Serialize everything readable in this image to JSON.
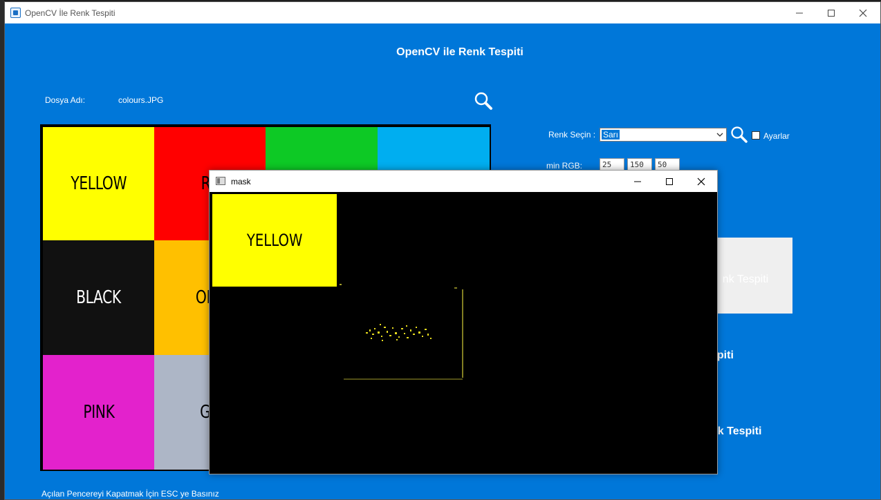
{
  "window": {
    "title": "OpenCV İle Renk Tespiti",
    "minimize_icon": "minimize-icon",
    "maximize_icon": "maximize-icon",
    "close_icon": "close-icon"
  },
  "main": {
    "heading": "OpenCV ile Renk Tespiti",
    "file_label": "Dosya Adı:",
    "file_name": "colours.JPG",
    "color_label": "Renk Seçin :",
    "color_selected": "Sarı",
    "settings_label": "Ayarlar",
    "min_rgb_label": "min RGB:",
    "min_rgb": [
      "25",
      "150",
      "50"
    ],
    "detect_button_partial": "nk Tespiti",
    "side_text_1": "spiti",
    "side_text_2": "nk Tespiti",
    "esc_note": "Açılan Pencereyi Kapatmak İçin ESC ye Basınız"
  },
  "image_grid": {
    "cells": [
      {
        "label": "YELLOW",
        "color": "#ffff00",
        "text_color": "#000000"
      },
      {
        "label": "RE",
        "color": "#ff0000",
        "text_color": "#000000"
      },
      {
        "label": "",
        "color": "#0dc925",
        "text_color": "#000000"
      },
      {
        "label": "",
        "color": "#00aef0",
        "text_color": "#000000"
      },
      {
        "label": "BLACK",
        "color": "#111111",
        "text_color": "#ffffff"
      },
      {
        "label": "ORA",
        "color": "#ffc000",
        "text_color": "#000000"
      },
      {
        "label": "PINK",
        "color": "#e322cc",
        "text_color": "#000000"
      },
      {
        "label": "GR",
        "color": "#adb6c6",
        "text_color": "#000000"
      }
    ]
  },
  "mask_window": {
    "title": "mask",
    "yellow_label": "YELLOW"
  }
}
